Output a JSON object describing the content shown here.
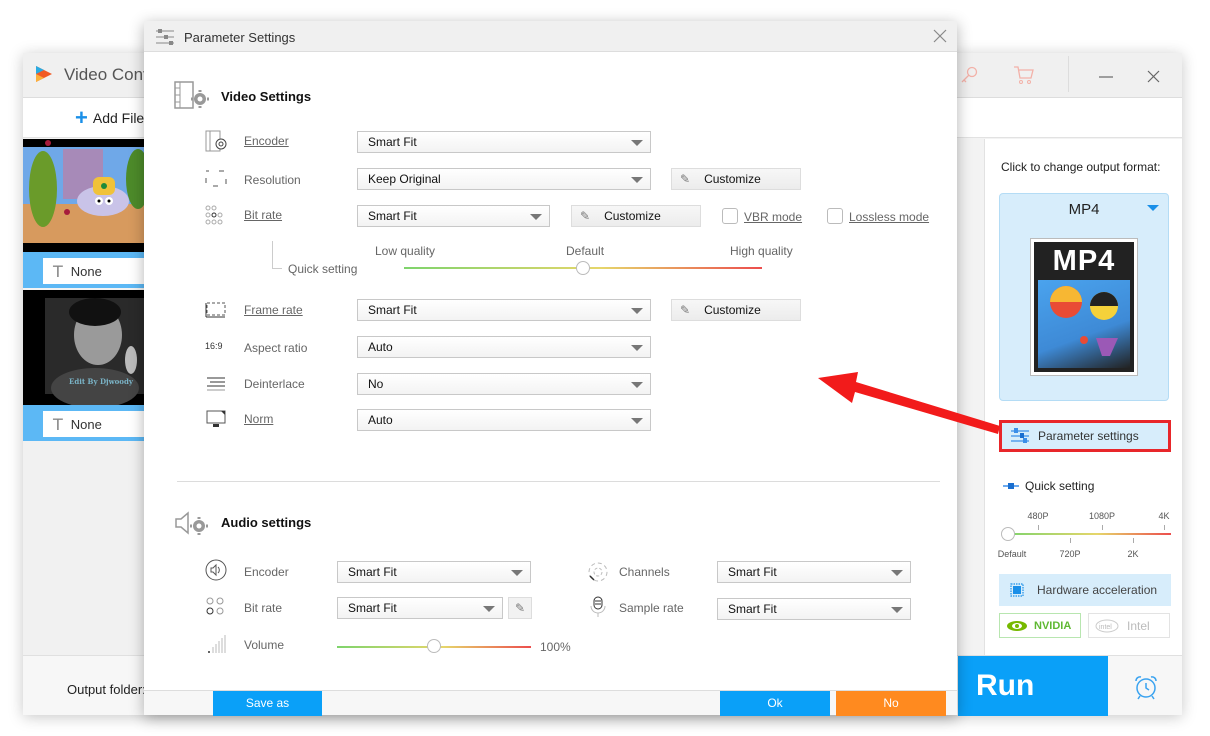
{
  "main_window": {
    "title": "Video Conv",
    "toolbar": {
      "add_file_label": "Add File"
    },
    "file_list": [
      {
        "subtitle": "None",
        "thumbnail": "cartoon-clip"
      },
      {
        "subtitle": "None",
        "thumbnail": "bw-clip",
        "overlay_text": "Edit By Djwoody"
      }
    ],
    "bottom": {
      "output_folder_label": "Output folder:",
      "run_label": "Run"
    },
    "icons": [
      "app-logo-icon",
      "key-icon",
      "cart-icon",
      "minimize-icon",
      "close-icon",
      "alarm-icon"
    ]
  },
  "right_panel": {
    "format_hint": "Click to change output format:",
    "format_name": "MP4",
    "format_thumb_label": "MP4",
    "parameter_settings_label": "Parameter settings",
    "quick_setting_label": "Quick setting",
    "resolution_ticks_top": [
      "480P",
      "1080P",
      "4K"
    ],
    "resolution_ticks_bottom": [
      "Default",
      "720P",
      "2K"
    ],
    "resolution_value": "Default",
    "hardware_acceleration_label": "Hardware acceleration",
    "nvidia_label": "NVIDIA",
    "intel_label": "Intel"
  },
  "dialog": {
    "title": "Parameter Settings",
    "video": {
      "section_title": "Video Settings",
      "encoder": {
        "label": "Encoder",
        "value": "Smart Fit"
      },
      "resolution": {
        "label": "Resolution",
        "value": "Keep Original",
        "customize": "Customize"
      },
      "bitrate": {
        "label": "Bit rate",
        "value": "Smart Fit",
        "customize": "Customize",
        "vbr_label": "VBR mode",
        "vbr_checked": false,
        "lossless_label": "Lossless mode",
        "lossless_checked": false
      },
      "quick_setting": {
        "label": "Quick setting",
        "low": "Low quality",
        "default": "Default",
        "high": "High quality",
        "value_fraction": 0.5
      },
      "frame_rate": {
        "label": "Frame rate",
        "value": "Smart Fit",
        "customize": "Customize"
      },
      "aspect_ratio": {
        "label": "Aspect ratio",
        "value": "Auto",
        "icon_text": "16:9"
      },
      "deinterlace": {
        "label": "Deinterlace",
        "value": "No"
      },
      "norm": {
        "label": "Norm",
        "value": "Auto"
      }
    },
    "audio": {
      "section_title": "Audio settings",
      "encoder": {
        "label": "Encoder",
        "value": "Smart Fit"
      },
      "channels": {
        "label": "Channels",
        "value": "Smart Fit"
      },
      "bitrate": {
        "label": "Bit rate",
        "value": "Smart Fit"
      },
      "sample_rate": {
        "label": "Sample rate",
        "value": "Smart Fit"
      },
      "volume": {
        "label": "Volume",
        "value": "100%",
        "value_fraction": 0.5
      }
    },
    "footer": {
      "save_as": "Save as",
      "ok": "Ok",
      "no": "No"
    }
  },
  "colors": {
    "accent_blue": "#0aa0f8",
    "orange": "#ff8a1f",
    "annotation_red": "#e8262a",
    "card_blue": "#d7edfb"
  }
}
